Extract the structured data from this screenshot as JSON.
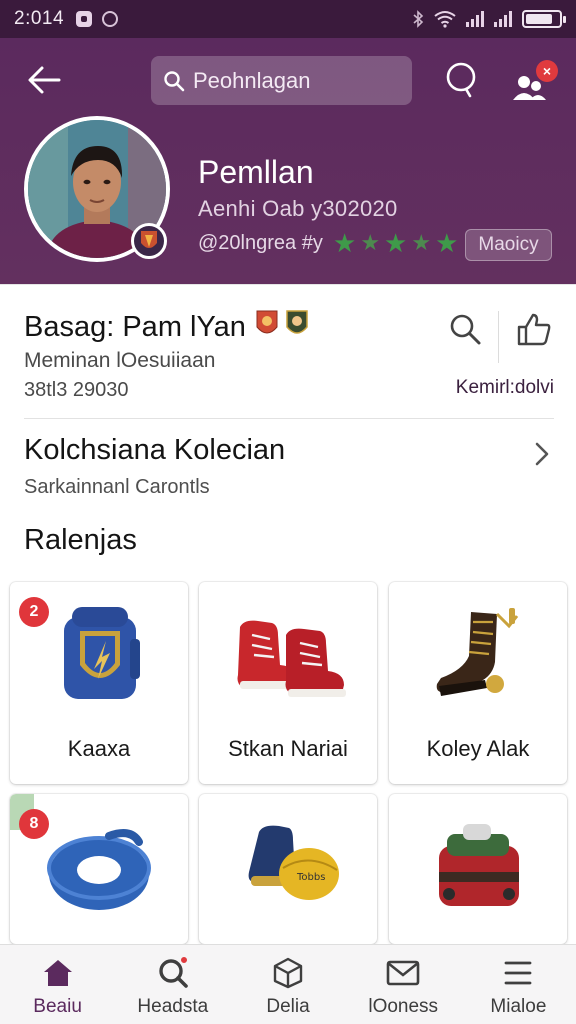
{
  "status_bar": {
    "time": "2:014",
    "battery_level": 0.8,
    "icons": [
      "bluetooth-icon",
      "wifi-icon",
      "signal-icon",
      "signal-icon",
      "battery-icon"
    ]
  },
  "header": {
    "search_placeholder": "Peohnlagan",
    "notification_count": "×",
    "profile": {
      "name": "Pemllan",
      "subtitle": "Aenhi Oab y302020",
      "tag": "@20lngrea #y",
      "stars": 5,
      "chip_label": "Maoicy"
    }
  },
  "player": {
    "title": "Basag: Pam lYan",
    "sub1": "Meminan lOesuiiaan",
    "sub2": "38tl3 29030",
    "like_label": "Kemirl:dolvi"
  },
  "collection": {
    "title": "Kolchsiana Kolecian",
    "subtitle": "Sarkainnanl Carontls"
  },
  "section_title": "Ralenjas",
  "items": [
    {
      "label": "Kaaxa",
      "badge": "2",
      "image": "shield-backpack-icon"
    },
    {
      "label": "Stkan Nariai",
      "badge": "",
      "image": "red-boots-icon"
    },
    {
      "label": "Koley Alak",
      "badge": "",
      "image": "brown-boot-icon"
    },
    {
      "label": "",
      "badge": "8",
      "image": "blue-ring-icon"
    },
    {
      "label": "",
      "badge": "",
      "image": "yellow-boot-icon"
    },
    {
      "label": "",
      "badge": "",
      "image": "red-bag-icon"
    }
  ],
  "nav": [
    {
      "label": "Beaiu",
      "icon": "home-icon",
      "active": true
    },
    {
      "label": "Headsta",
      "icon": "search-icon",
      "active": false
    },
    {
      "label": "Delia",
      "icon": "box-icon",
      "active": false
    },
    {
      "label": "lOoness",
      "icon": "mail-icon",
      "active": false
    },
    {
      "label": "Mialoe",
      "icon": "menu-icon",
      "active": false
    }
  ]
}
